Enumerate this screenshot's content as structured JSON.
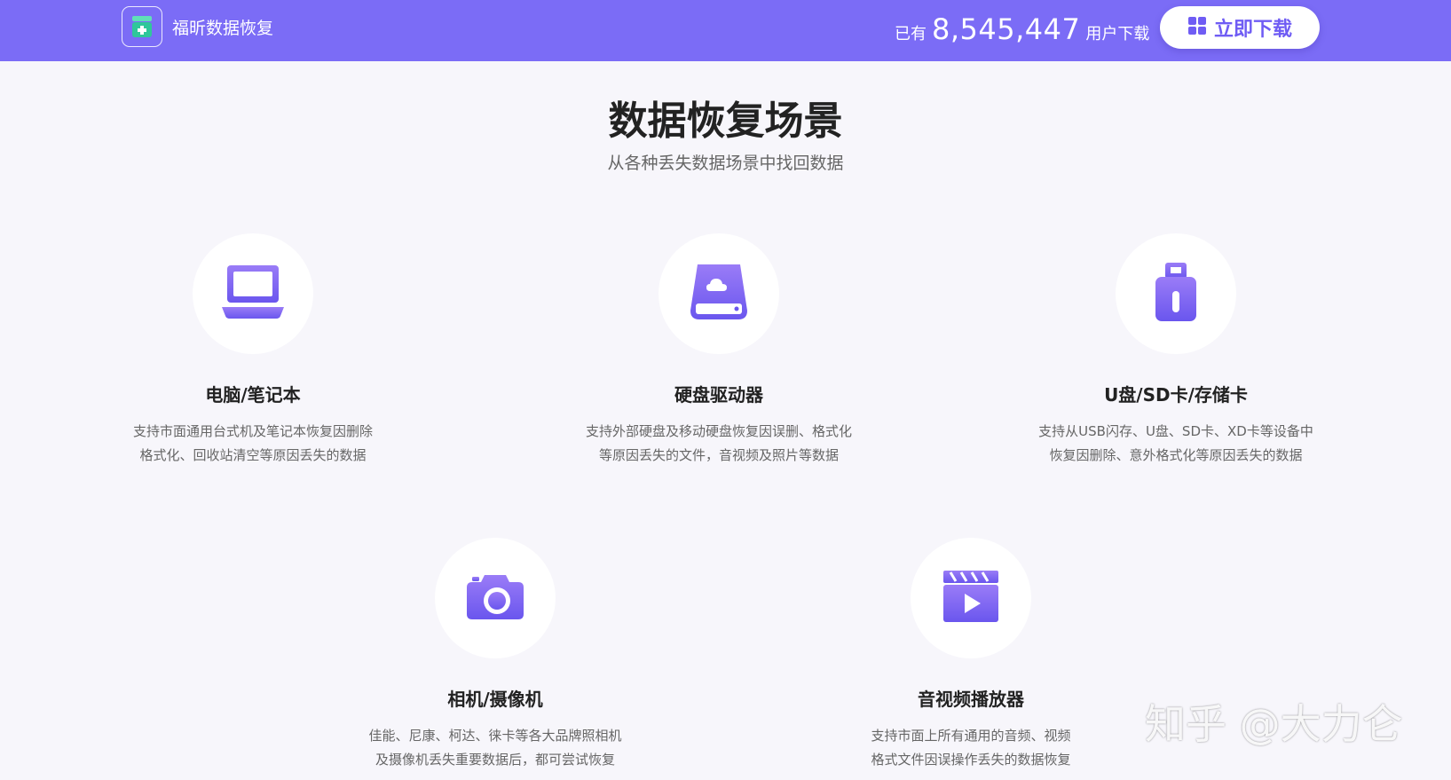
{
  "header": {
    "app_name": "福昕数据恢复",
    "stats_prefix": "已有",
    "download_count": "8,545,447",
    "stats_suffix": "用户下载",
    "download_button": "立即下载",
    "colors": {
      "bar": "#7b6cf6",
      "accent": "#6f5cf4"
    }
  },
  "section": {
    "title": "数据恢复场景",
    "subtitle": "从各种丢失数据场景中找回数据"
  },
  "scenarios": [
    {
      "icon": "laptop-icon",
      "title": "电脑/笔记本",
      "desc_line1": "支持市面通用台式机及笔记本恢复因删除",
      "desc_line2": "格式化、回收站清空等原因丢失的数据"
    },
    {
      "icon": "hard-drive-icon",
      "title": "硬盘驱动器",
      "desc_line1": "支持外部硬盘及移动硬盘恢复因误删、格式化",
      "desc_line2": "等原因丢失的文件，音视频及照片等数据"
    },
    {
      "icon": "usb-drive-icon",
      "title": "U盘/SD卡/存储卡",
      "desc_line1": "支持从USB闪存、U盘、SD卡、XD卡等设备中",
      "desc_line2": "恢复因删除、意外格式化等原因丢失的数据"
    },
    {
      "icon": "camera-icon",
      "title": "相机/摄像机",
      "desc_line1": "佳能、尼康、柯达、徕卡等各大品牌照相机",
      "desc_line2": "及摄像机丢失重要数据后，都可尝试恢复"
    },
    {
      "icon": "video-player-icon",
      "title": "音视频播放器",
      "desc_line1": "支持市面上所有通用的音频、视频",
      "desc_line2": "格式文件因误操作丢失的数据恢复"
    }
  ],
  "watermark": "知乎 @大力仑"
}
